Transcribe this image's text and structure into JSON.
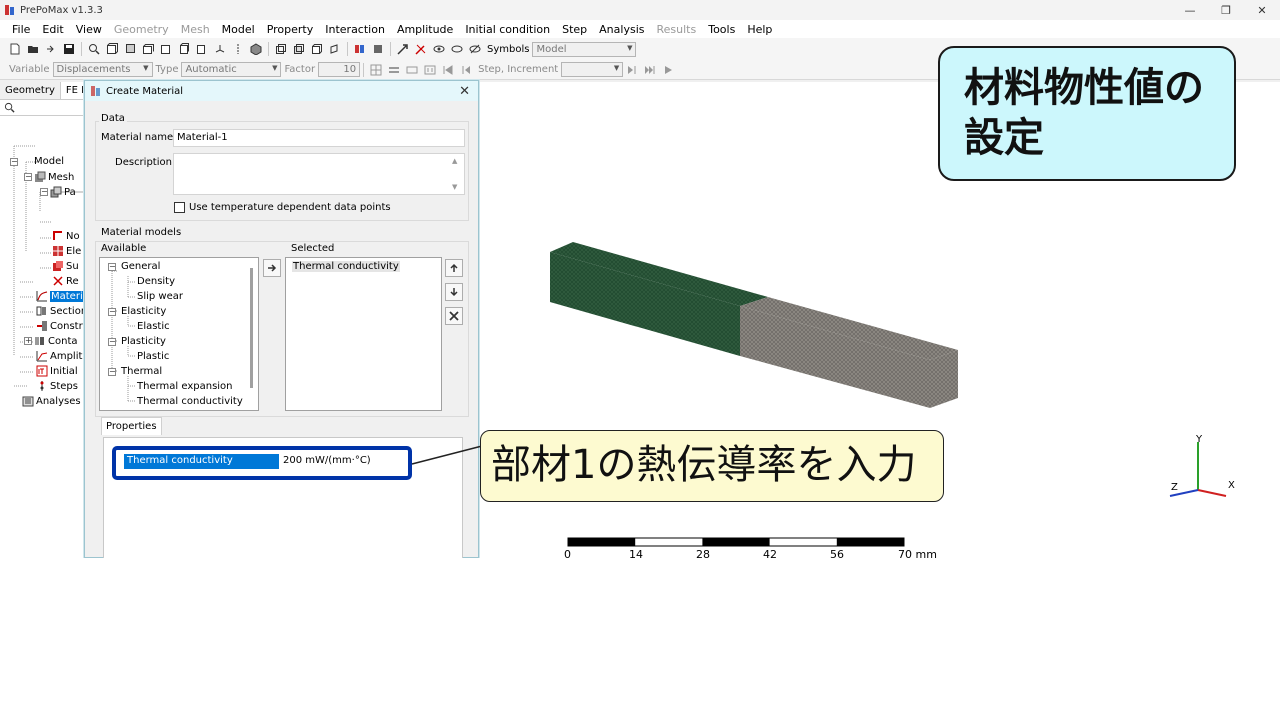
{
  "window": {
    "title": "PrePoMax v1.3.3",
    "minimize": "—",
    "maximize": "❐",
    "close": "✕"
  },
  "menu": [
    {
      "label": "File",
      "enabled": true
    },
    {
      "label": "Edit",
      "enabled": true
    },
    {
      "label": "View",
      "enabled": true
    },
    {
      "label": "Geometry",
      "enabled": false
    },
    {
      "label": "Mesh",
      "enabled": false
    },
    {
      "label": "Model",
      "enabled": true
    },
    {
      "label": "Property",
      "enabled": true
    },
    {
      "label": "Interaction",
      "enabled": true
    },
    {
      "label": "Amplitude",
      "enabled": true
    },
    {
      "label": "Initial condition",
      "enabled": true
    },
    {
      "label": "Step",
      "enabled": true
    },
    {
      "label": "Analysis",
      "enabled": true
    },
    {
      "label": "Results",
      "enabled": false
    },
    {
      "label": "Tools",
      "enabled": true
    },
    {
      "label": "Help",
      "enabled": true
    }
  ],
  "toolbar1": {
    "symbols_label": "Symbols",
    "symbols_value": "Model"
  },
  "toolbar2": {
    "variable_label": "Variable",
    "variable_value": "Displacements",
    "type_label": "Type",
    "type_value": "Automatic",
    "factor_label": "Factor",
    "factor_value": "10",
    "step_label": "Step, Increment",
    "step_value": ""
  },
  "left_panel": {
    "tabs": [
      "Geometry",
      "FE Mo"
    ],
    "tree": {
      "model": "Model",
      "mesh": "Mesh",
      "parts": "Pa",
      "nodes": "No",
      "elements": "Ele",
      "surfaces": "Su",
      "reference": "Re",
      "materials": "Materi",
      "sections": "Section",
      "constraints": "Constr",
      "contacts": "Conta",
      "amplitudes": "Amplit",
      "initial": "Initial",
      "steps": "Steps",
      "analyses": "Analyses"
    }
  },
  "dialog": {
    "title": "Create Material",
    "close": "✕",
    "data_group": "Data",
    "material_name_label": "Material name",
    "material_name_value": "Material-1",
    "description_label": "Description",
    "description_value": "",
    "temp_checkbox_label": "Use temperature dependent data points",
    "temp_checked": false,
    "models_group": "Material models",
    "available_label": "Available",
    "selected_label": "Selected",
    "available_tree": {
      "general": "General",
      "density": "Density",
      "slip_wear": "Slip wear",
      "elasticity": "Elasticity",
      "elastic": "Elastic",
      "plasticity": "Plasticity",
      "plastic": "Plastic",
      "thermal": "Thermal",
      "thermal_expansion": "Thermal expansion",
      "thermal_conductivity": "Thermal conductivity"
    },
    "selected_items": [
      "Thermal conductivity"
    ],
    "properties_tab": "Properties",
    "property_name": "Thermal conductivity",
    "property_value": "200 mW/(mm·°C)"
  },
  "scale_bar": {
    "labels": [
      "0",
      "14",
      "28",
      "42",
      "56",
      "70 mm"
    ]
  },
  "axes": {
    "x": "X",
    "y": "Y",
    "z": "Z"
  },
  "colors": {
    "part1": "#234d32",
    "part2": "#8a8680",
    "selection": "#0078d7",
    "highlight": "#0033a8",
    "callout_title_bg": "#ccf7fc",
    "callout_note_bg": "#fdfad0"
  },
  "annotations": {
    "title_callout_line1": "材料物性値の",
    "title_callout_line2": "設定",
    "note_callout": "部材1の熱伝導率を入力"
  }
}
